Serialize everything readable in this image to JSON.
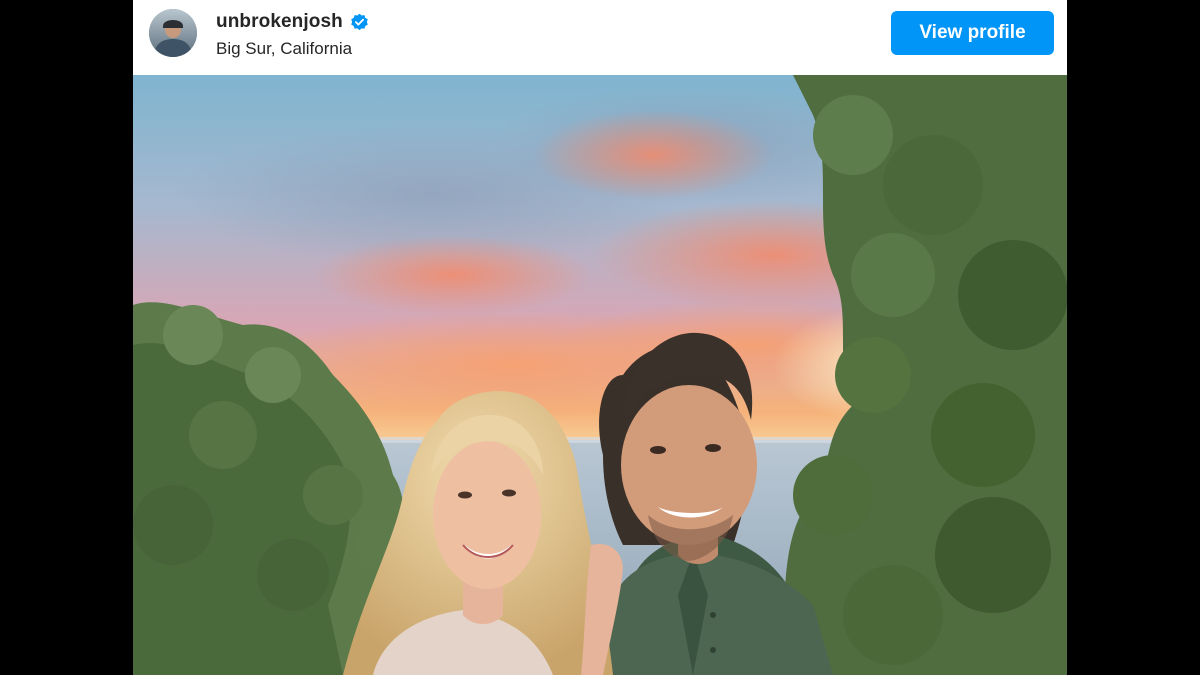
{
  "post": {
    "username": "unbrokenjosh",
    "location": "Big Sur, California",
    "view_profile_label": "View profile",
    "avatar_icon": "profile-avatar",
    "verified_icon": "verified-badge-icon",
    "photo_subject": "couple-sunset-photo"
  },
  "colors": {
    "accent": "#0095f6",
    "text": "#262626",
    "letterbox": "#000000"
  }
}
